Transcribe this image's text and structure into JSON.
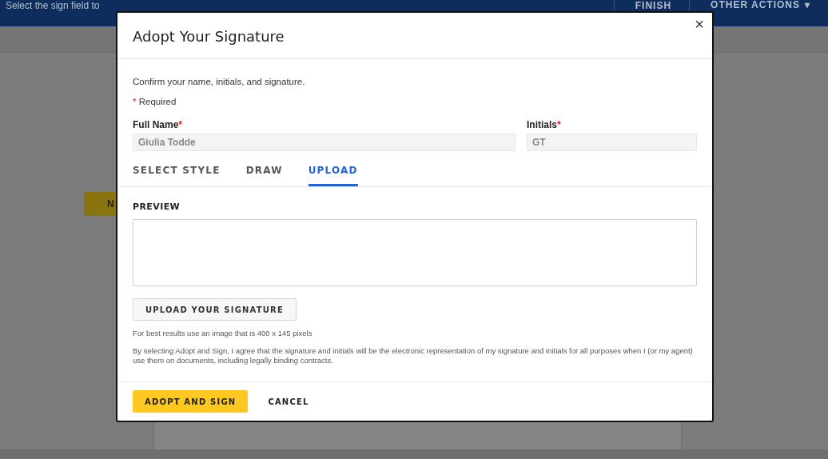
{
  "top_bar": {
    "message": "Select the sign field to",
    "finish": "FINISH",
    "other_actions": "OTHER ACTIONS",
    "other_actions_caret": "▾"
  },
  "background_button": {
    "label": "N"
  },
  "dialog": {
    "title": "Adopt Your Signature",
    "close": "×",
    "intro": "Confirm your name, initials, and signature.",
    "required_mark": "*",
    "required": "Required",
    "fields": [
      {
        "label": "Full Name",
        "required": true,
        "value": "Giulia Todde"
      },
      {
        "label": "Initials",
        "required": true,
        "value": "GT"
      }
    ],
    "tabs": [
      {
        "label": "SELECT STYLE",
        "selected": false
      },
      {
        "label": "DRAW",
        "selected": false
      },
      {
        "label": "UPLOAD",
        "selected": true
      }
    ],
    "preview_label": "PREVIEW",
    "upload_button": "UPLOAD YOUR SIGNATURE",
    "hint": "For best results use an image that is 400 x 145 pixels",
    "consent": "By selecting Adopt and Sign, I agree that the signature and initials will be the electronic representation of my signature and initials for all purposes when I (or my agent) use them on documents, including legally binding contracts.",
    "buttons": [
      {
        "label": "ADOPT AND SIGN",
        "kind": "primary"
      },
      {
        "label": "CANCEL",
        "kind": "text"
      }
    ]
  }
}
